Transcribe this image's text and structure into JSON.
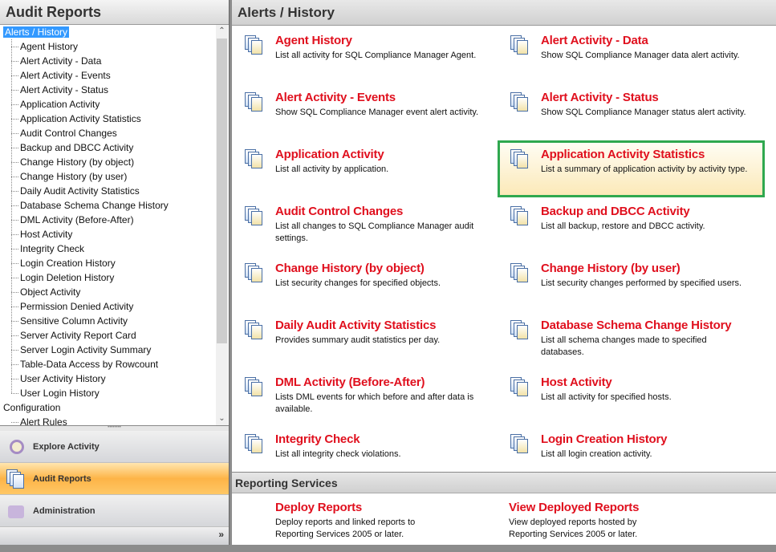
{
  "left": {
    "title": "Audit Reports",
    "tree": {
      "root": "Alerts /  History",
      "children": [
        "Agent History",
        "Alert Activity - Data",
        "Alert Activity - Events",
        "Alert Activity - Status",
        "Application Activity",
        "Application Activity Statistics",
        "Audit Control Changes",
        "Backup and DBCC Activity",
        "Change History (by object)",
        "Change History (by user)",
        "Daily Audit Activity Statistics",
        "Database Schema Change History",
        "DML Activity (Before-After)",
        "Host Activity",
        "Integrity Check",
        "Login Creation History",
        "Login Deletion History",
        "Object Activity",
        "Permission Denied Activity",
        "Sensitive Column Activity",
        "Server Activity Report Card",
        "Server Login Activity Summary",
        "Table-Data Access by Rowcount",
        "User Activity History",
        "User Login History"
      ],
      "root2": "Configuration",
      "children2": [
        "Alert Rules"
      ]
    },
    "nav": [
      "Explore Activity",
      "Audit Reports",
      "Administration"
    ],
    "more": "»"
  },
  "right": {
    "title": "Alerts /  History",
    "items": [
      {
        "t": "Agent History",
        "d": "List all activity for SQL Compliance Manager Agent."
      },
      {
        "t": "Alert Activity - Data",
        "d": "Show SQL Compliance Manager data alert activity."
      },
      {
        "t": "Alert Activity - Events",
        "d": "Show SQL Compliance Manager event alert activity."
      },
      {
        "t": "Alert Activity - Status",
        "d": "Show SQL Compliance Manager status alert activity."
      },
      {
        "t": "Application Activity",
        "d": "List all activity by application."
      },
      {
        "t": "Application Activity Statistics",
        "d": "List a summary of application activity by activity type."
      },
      {
        "t": "Audit Control Changes",
        "d": "List all changes to SQL Compliance Manager audit settings."
      },
      {
        "t": "Backup and DBCC Activity",
        "d": "List all backup, restore and DBCC activity."
      },
      {
        "t": "Change History (by object)",
        "d": "List security changes for specified objects."
      },
      {
        "t": "Change History (by user)",
        "d": "List security changes performed by specified users."
      },
      {
        "t": "Daily Audit Activity Statistics",
        "d": "Provides summary audit statistics per day."
      },
      {
        "t": "Database Schema Change History",
        "d": "List all schema changes made to specified databases."
      },
      {
        "t": "DML Activity (Before-After)",
        "d": "Lists DML events for which before and after data is available."
      },
      {
        "t": "Host Activity",
        "d": "List all activity for specified hosts."
      },
      {
        "t": "Integrity Check",
        "d": "List all integrity check violations."
      },
      {
        "t": "Login Creation History",
        "d": "List all login creation activity."
      }
    ],
    "rs_title": "Reporting Services",
    "rs_items": [
      {
        "t": "Deploy Reports",
        "d": "Deploy reports and linked reports to Reporting Services 2005 or later."
      },
      {
        "t": "View Deployed Reports",
        "d": "View deployed reports hosted by Reporting Services 2005 or later."
      }
    ]
  }
}
